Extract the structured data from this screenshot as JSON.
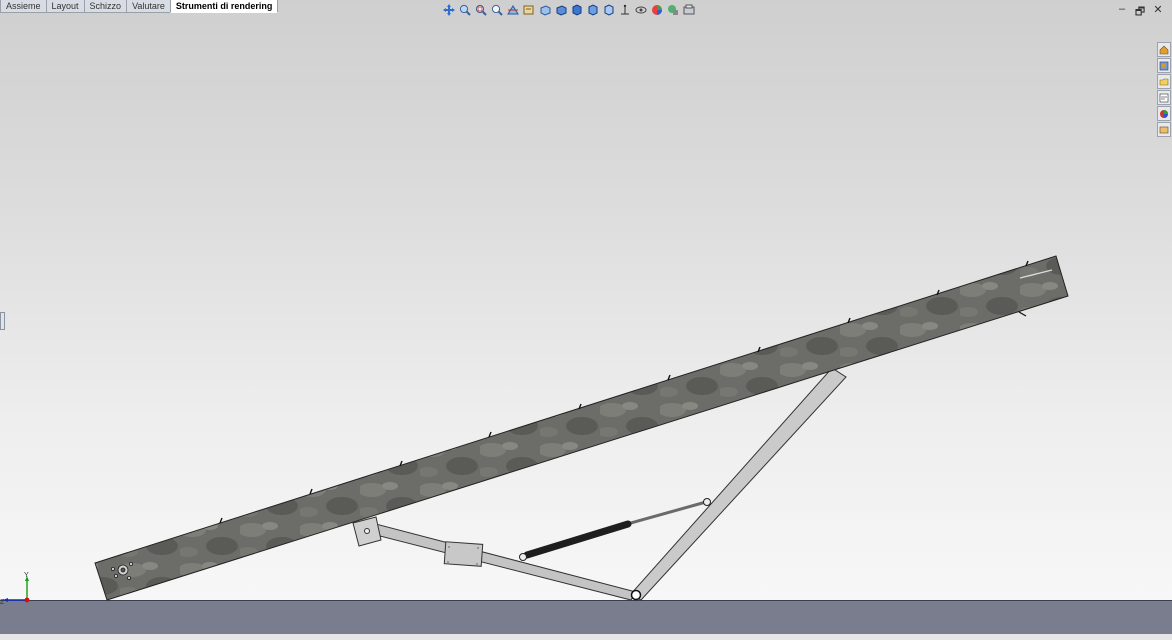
{
  "tabs": [
    {
      "label": "Assieme",
      "active": false
    },
    {
      "label": "Layout",
      "active": false
    },
    {
      "label": "Schizzo",
      "active": false
    },
    {
      "label": "Valutare",
      "active": false
    },
    {
      "label": "Strumenti di rendering",
      "active": true
    }
  ],
  "view_toolbar": [
    "pan-icon",
    "zoom-to-fit-icon",
    "zoom-area-icon",
    "previous-view-icon",
    "section-view-icon",
    "dynamic-annotation-icon",
    "view-orientation-icon",
    "display-style-icon",
    "shaded-icon",
    "hidden-lines-icon",
    "wireframe-icon",
    "perspective-icon",
    "hide-show-icon",
    "appearance-icon",
    "scene-icon",
    "view-settings-icon"
  ],
  "window_controls": {
    "minimize": "–",
    "restore": "🗗",
    "close": "✕"
  },
  "task_pane": [
    "home-icon",
    "design-library-icon",
    "file-explorer-icon",
    "view-palette-icon",
    "appearances-icon",
    "custom-properties-icon"
  ],
  "triad": {
    "y_label": "Y",
    "z_label": "Z"
  },
  "colors": {
    "floor": "#7a7d8e",
    "beam": "#6a6a66",
    "strut": "#c9c9c9",
    "cylinder": "#222222",
    "x_axis": "#d01010",
    "y_axis": "#10a010",
    "z_axis": "#1030c0"
  }
}
